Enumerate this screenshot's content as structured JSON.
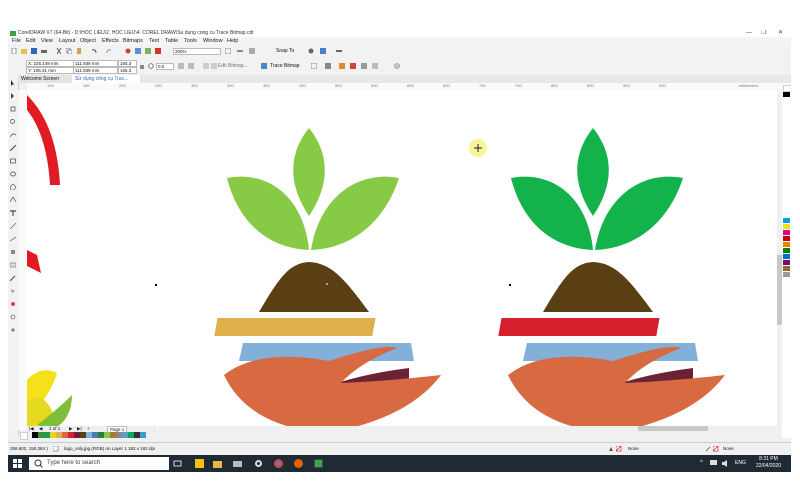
{
  "window": {
    "title": "CorelDRAW X7 (64-Bit) - D:\\HOC LIEU\\2. HOC LIEU\\4. COREL DRAW\\Su dung cong cu Trace Bitmap.cdr"
  },
  "menu": [
    "File",
    "Edit",
    "View",
    "Layout",
    "Object",
    "Effects",
    "Bitmaps",
    "Text",
    "Table",
    "Tools",
    "Window",
    "Help"
  ],
  "toolbar": {
    "zoom_value": "200%",
    "snap_to_label": "Snap To"
  },
  "property_bar": {
    "x": "X: 225.149 mm",
    "y": "Y: 106.31 mm",
    "width": "111.938 mm",
    "height": "111.938 mm",
    "scale_w": "165.3",
    "scale_h": "165.3",
    "angle": "0.0",
    "edit_bitmap_label": "Edit Bitmap...",
    "trace_bitmap_label": "Trace Bitmap"
  },
  "tabs": [
    {
      "label": "Welcome Screen"
    },
    {
      "label": "Sử dụng công cụ Trac..."
    }
  ],
  "ruler_labels": [
    "100",
    "150",
    "200",
    "250",
    "300",
    "350",
    "400",
    "450",
    "500",
    "550",
    "600",
    "650",
    "700",
    "750",
    "800",
    "850",
    "900",
    "950",
    "millimeters"
  ],
  "page_nav": {
    "count": "1 of 1",
    "page_label": "Page 1"
  },
  "status": {
    "coords": "266.602, 150.384 )",
    "object_info": "logo_only.jpg (RGB) on Layer 1 182 x 182 dpi",
    "fill_label": "None",
    "outline_label": "None"
  },
  "taskbar": {
    "search_placeholder": "Type here to search",
    "time": "8:31 PM",
    "date": "22/04/2020",
    "lang": "ENG"
  },
  "colors": {
    "leaf_left": "#87ca45",
    "leaf_right": "#13b24a",
    "soil": "#5a3f15",
    "band_yellow": "#dfb04a",
    "band_red": "#d6202e",
    "band_blue": "#82b0d9",
    "hand": "#d86a42",
    "stripe_dark": "#6c2236",
    "corner_red": "#e01b24"
  }
}
